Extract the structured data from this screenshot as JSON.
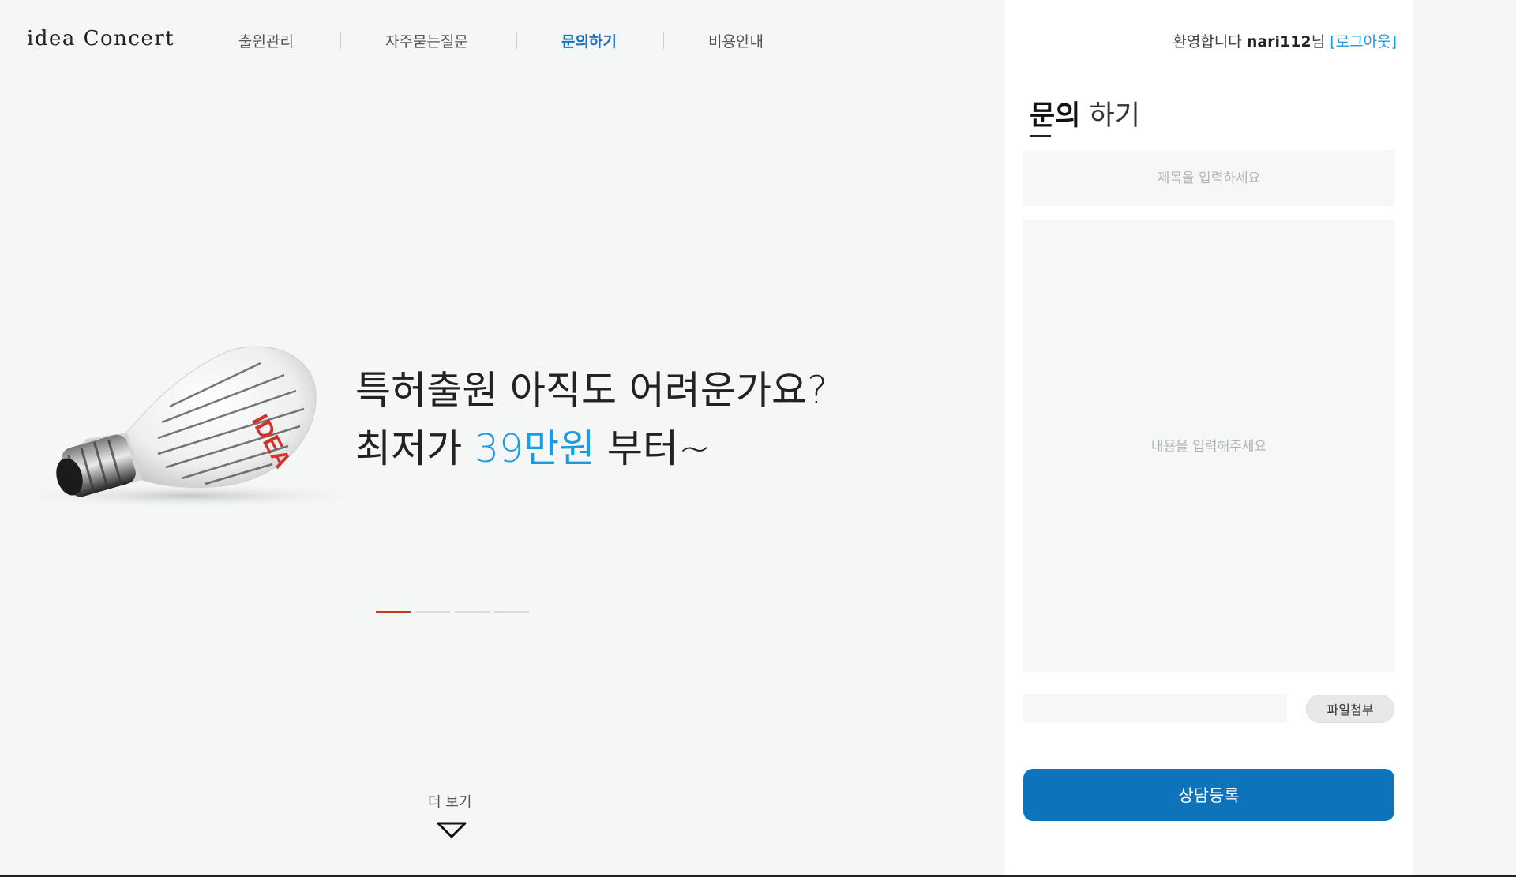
{
  "header": {
    "logo": "idea Concert",
    "nav": [
      {
        "label": "출원관리",
        "active": false
      },
      {
        "label": "자주묻는질문",
        "active": false
      },
      {
        "label": "문의하기",
        "active": true
      },
      {
        "label": "비용안내",
        "active": false
      }
    ],
    "welcome_prefix": "환영합니다 ",
    "username": "nari112",
    "welcome_suffix": "님",
    "logout_label": "[로그아웃]"
  },
  "hero": {
    "line1": "특허출원 아직도 어려운가요?",
    "line2_prefix": "최저가 ",
    "line2_price": "39만원",
    "line2_suffix": " 부터~",
    "bulb_text": "IDEA",
    "slides": {
      "count": 4,
      "active_index": 0
    },
    "more_label": "더 보기"
  },
  "inquiry_form": {
    "title_strong": "문의",
    "title_rest": " 하기",
    "title_placeholder": "제목을 입력하세요",
    "content_placeholder": "내용을 입력해주세요",
    "attach_label": "파일첨부",
    "submit_label": "상담등록"
  },
  "colors": {
    "accent": "#1a73c2",
    "price": "#1a9be6",
    "submit": "#0d73bb",
    "indicator_active": "#c0392b",
    "idea_red": "#d0342c"
  }
}
